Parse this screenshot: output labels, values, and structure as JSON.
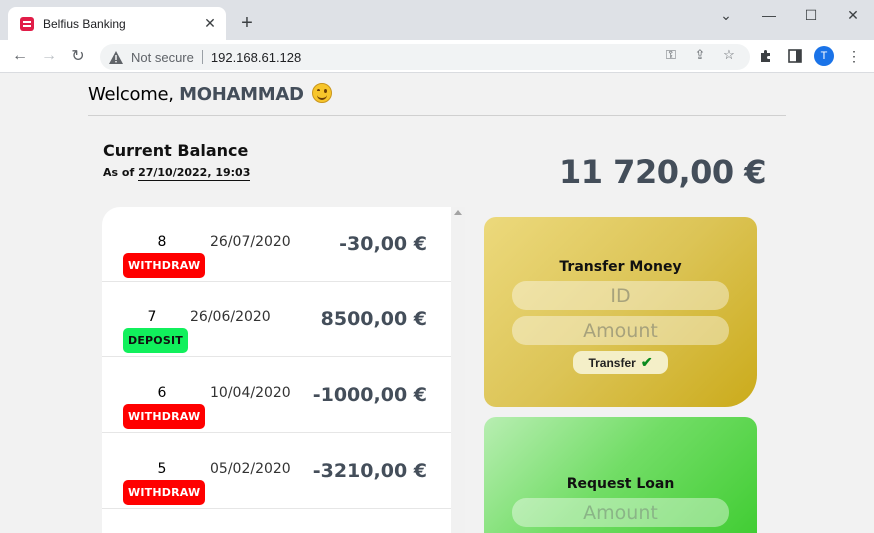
{
  "browser": {
    "tab_title": "Belfius Banking",
    "security_label": "Not secure",
    "url": "192.168.61.128",
    "profile_initial": "T"
  },
  "header": {
    "welcome_prefix": "Welcome, ",
    "username": "MOHAMMAD"
  },
  "balance": {
    "title": "Current Balance",
    "as_of_prefix": "As of ",
    "as_of_date": "27/10/2022, 19:03",
    "amount": "11 720,00 €"
  },
  "movements": [
    {
      "number": "8",
      "type": "WITHDRAW",
      "date": "26/07/2020",
      "amount": "-30,00 €"
    },
    {
      "number": "7",
      "type": "DEPOSIT",
      "date": "26/06/2020",
      "amount": "8500,00 €"
    },
    {
      "number": "6",
      "type": "WITHDRAW",
      "date": "10/04/2020",
      "amount": "-1000,00 €"
    },
    {
      "number": "5",
      "type": "WITHDRAW",
      "date": "05/02/2020",
      "amount": "-3210,00 €"
    }
  ],
  "transfer": {
    "title": "Transfer Money",
    "id_placeholder": "ID",
    "amount_placeholder": "Amount",
    "button_label": "Transfer",
    "button_icon": "✔"
  },
  "loan": {
    "title": "Request Loan",
    "amount_placeholder": "Amount"
  },
  "colors": {
    "withdraw": "#ff0000",
    "deposit": "#11f05c",
    "accent_text": "#444e5a"
  }
}
